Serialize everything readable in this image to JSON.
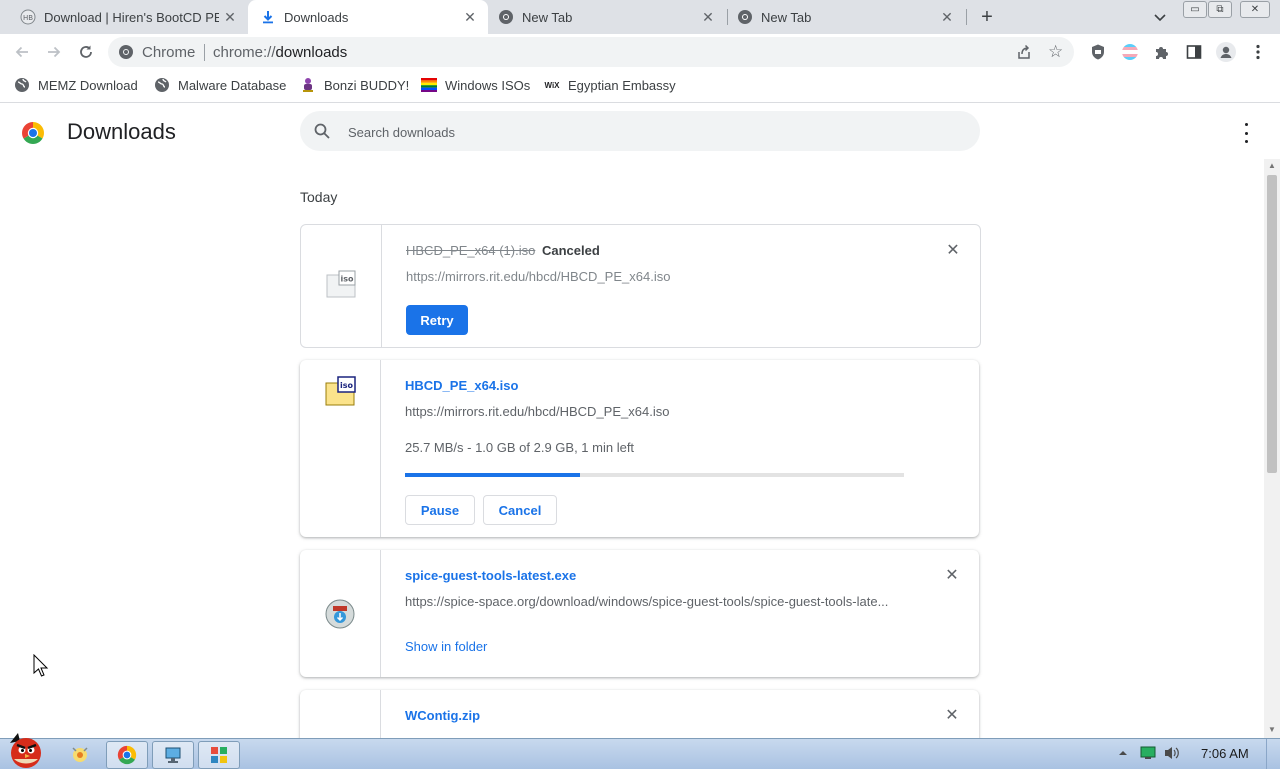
{
  "tabs": [
    {
      "title": "Download | Hiren's BootCD PE",
      "close": "✕"
    },
    {
      "title": "Downloads",
      "close": "✕",
      "active": true
    },
    {
      "title": "New Tab",
      "close": "✕"
    },
    {
      "title": "New Tab",
      "close": "✕"
    }
  ],
  "window": {
    "minimize": "▭",
    "restore": "⧉",
    "close": "✕",
    "new_tab": "+"
  },
  "omnibox": {
    "label": "Chrome",
    "scheme": "chrome://",
    "path": "downloads"
  },
  "bookmarks": [
    {
      "label": "MEMZ Download"
    },
    {
      "label": "Malware Database"
    },
    {
      "label": "Bonzi BUDDY!"
    },
    {
      "label": "Windows ISOs"
    },
    {
      "label": "Egyptian Embassy",
      "icon_text": "WiX"
    }
  ],
  "page": {
    "title": "Downloads",
    "search_placeholder": "Search downloads",
    "section_date": "Today"
  },
  "downloads": [
    {
      "name": "HBCD_PE_x64 (1).iso",
      "status": "Canceled",
      "url": "https://mirrors.rit.edu/hbcd/HBCD_PE_x64.iso",
      "retry_label": "Retry",
      "close": "✕"
    },
    {
      "name": "HBCD_PE_x64.iso",
      "url": "https://mirrors.rit.edu/hbcd/HBCD_PE_x64.iso",
      "progress_text": "25.7 MB/s - 1.0 GB of 2.9 GB, 1 min left",
      "progress_fraction": 0.35,
      "pause_label": "Pause",
      "cancel_label": "Cancel"
    },
    {
      "name": "spice-guest-tools-latest.exe",
      "url": "https://spice-space.org/download/windows/spice-guest-tools/spice-guest-tools-late...",
      "show_in_folder": "Show in folder",
      "close": "✕"
    },
    {
      "name": "WContig.zip",
      "close": "✕"
    }
  ],
  "taskbar": {
    "clock": "7:06 AM"
  },
  "colors": {
    "accent": "#1a73e8",
    "tabstrip": "#dee1e6",
    "omnibox": "#f1f3f4"
  }
}
